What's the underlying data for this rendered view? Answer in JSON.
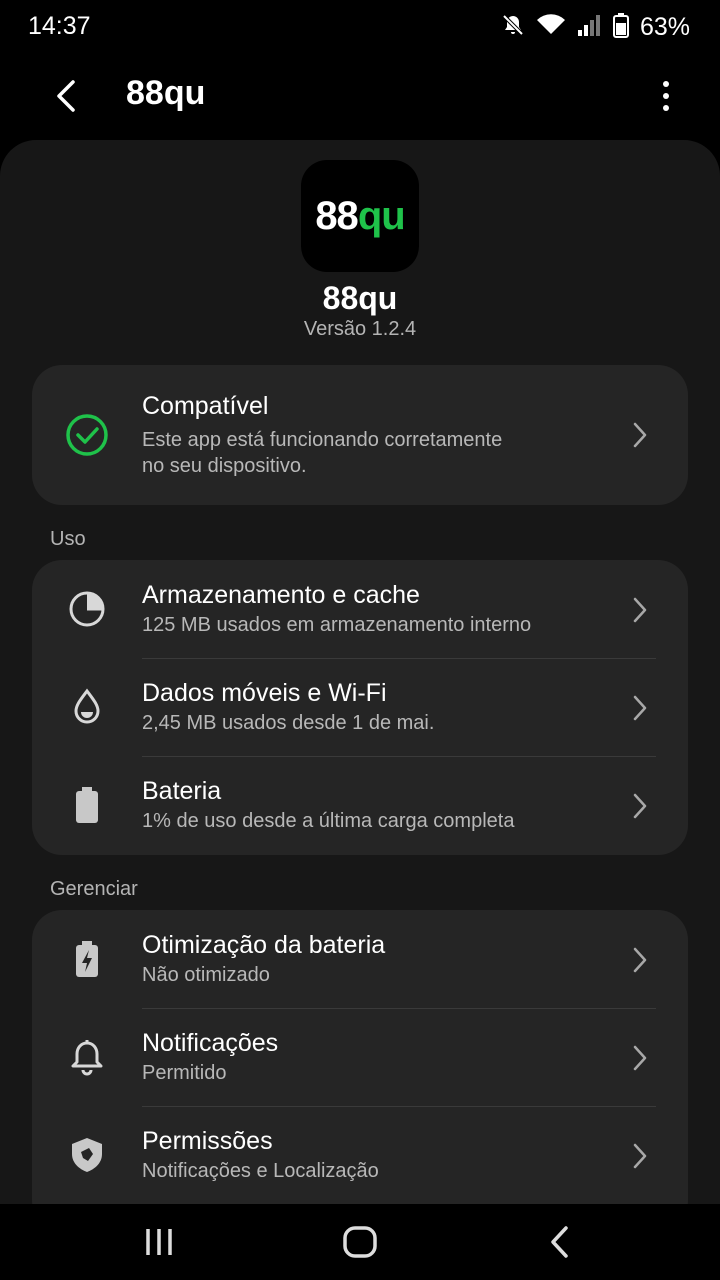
{
  "status_bar": {
    "time": "14:37",
    "battery_percent": "63%",
    "icons": [
      "mute-icon",
      "wifi-icon",
      "signal-icon",
      "battery-icon"
    ]
  },
  "top_bar": {
    "title": "88qu",
    "back_icon": "back-arrow-icon",
    "more_icon": "more-vert-icon"
  },
  "app": {
    "logo_text_white": "88",
    "logo_text_green": "qu",
    "name": "88qu",
    "version": "Versão 1.2.4"
  },
  "compat": {
    "title": "Compatível",
    "subtitle_line1": "Este app está funcionando corretamente",
    "subtitle_line2": "no seu dispositivo.",
    "icon": "check-circle-icon"
  },
  "sections": {
    "uso": "Uso",
    "gerenciar": "Gerenciar"
  },
  "uso_items": [
    {
      "title": "Armazenamento e cache",
      "subtitle": "125 MB usados em armazenamento interno",
      "icon": "storage-pie-icon"
    },
    {
      "title": "Dados móveis e Wi-Fi",
      "subtitle": "2,45 MB usados desde 1 de mai.",
      "icon": "data-drop-icon"
    },
    {
      "title": "Bateria",
      "subtitle": "1% de uso desde a última carga completa",
      "icon": "battery-icon"
    }
  ],
  "gerenciar_items": [
    {
      "title": "Otimização da bateria",
      "subtitle": "Não otimizado",
      "icon": "battery-bolt-icon"
    },
    {
      "title": "Notificações",
      "subtitle": "Permitido",
      "icon": "bell-icon"
    },
    {
      "title": "Permissões",
      "subtitle": "Notificações e Localização",
      "icon": "shield-icon"
    }
  ],
  "nav_bar": {
    "icons": [
      "recents-icon",
      "home-icon",
      "nav-back-icon"
    ]
  },
  "colors": {
    "background": "#000000",
    "sheet": "#171717",
    "card": "#252525",
    "accent_green": "#1fc24a"
  }
}
